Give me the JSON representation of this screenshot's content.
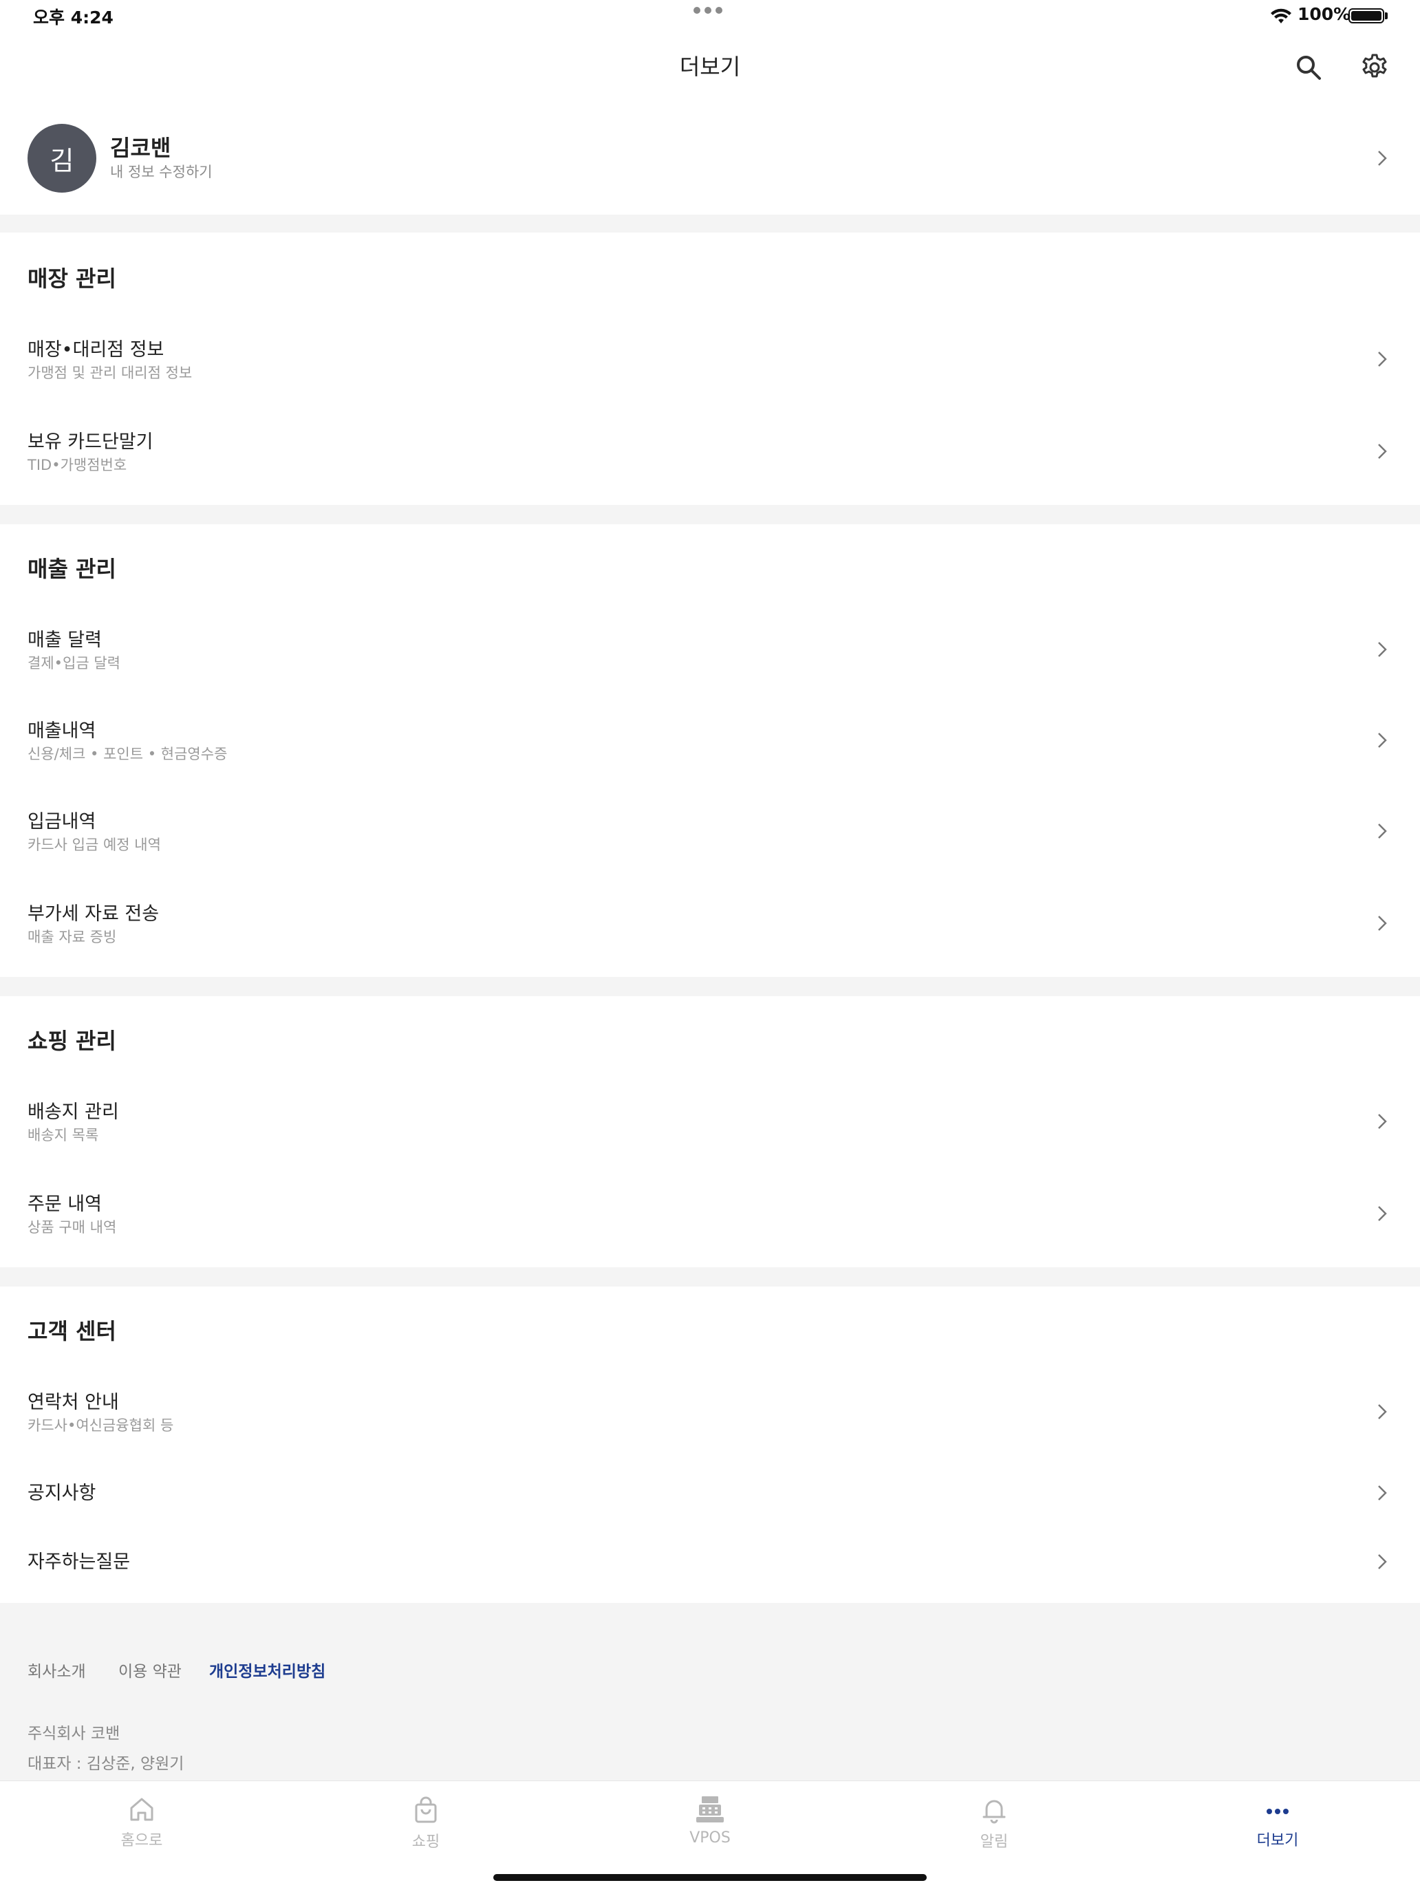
{
  "status_bar": {
    "time": "오후 4:24",
    "battery": "100%"
  },
  "nav": {
    "title": "더보기",
    "search_icon": "search-icon",
    "settings_icon": "gear-icon"
  },
  "profile": {
    "avatar_initial": "김",
    "name": "김코밴",
    "subtitle": "내 정보 수정하기"
  },
  "sections": {
    "store": {
      "title": "매장 관리",
      "items": [
        {
          "title": "매장•대리점 정보",
          "subtitle": "가맹점 및 관리 대리점 정보"
        },
        {
          "title": "보유 카드단말기",
          "subtitle": "TID•가맹점번호"
        }
      ]
    },
    "sales": {
      "title": "매출 관리",
      "items": [
        {
          "title": "매출 달력",
          "subtitle": "결제•입금 달력"
        },
        {
          "title": "매출내역",
          "subtitle": "신용/체크 • 포인트 • 현금영수증"
        },
        {
          "title": "입금내역",
          "subtitle": "카드사 입금 예정 내역"
        },
        {
          "title": "부가세 자료 전송",
          "subtitle": "매출 자료 증빙"
        }
      ]
    },
    "shopping": {
      "title": "쇼핑 관리",
      "items": [
        {
          "title": "배송지 관리",
          "subtitle": "배송지 목록"
        },
        {
          "title": "주문 내역",
          "subtitle": "상품 구매 내역"
        }
      ]
    },
    "support": {
      "title": "고객 센터",
      "items": [
        {
          "title": "연락처 안내",
          "subtitle": "카드사•여신금융협회 등"
        },
        {
          "title": "공지사항"
        },
        {
          "title": "자주하는질문"
        }
      ]
    }
  },
  "footer": {
    "links": [
      "회사소개",
      "이용 약관",
      "개인정보처리방침"
    ],
    "company": "주식회사 코밴",
    "ceo": "대표자 : 김상준, 양원기"
  },
  "tabs": [
    {
      "label": "홈으로",
      "icon": "home-icon"
    },
    {
      "label": "쇼핑",
      "icon": "shopping-bag-icon"
    },
    {
      "label": "VPOS",
      "icon": "pos-terminal-icon"
    },
    {
      "label": "알림",
      "icon": "bell-icon"
    },
    {
      "label": "더보기",
      "icon": "more-dots-icon"
    }
  ],
  "colors": {
    "accent": "#1d3c8f",
    "avatar": "#51545e",
    "divider": "#f4f4f4"
  }
}
